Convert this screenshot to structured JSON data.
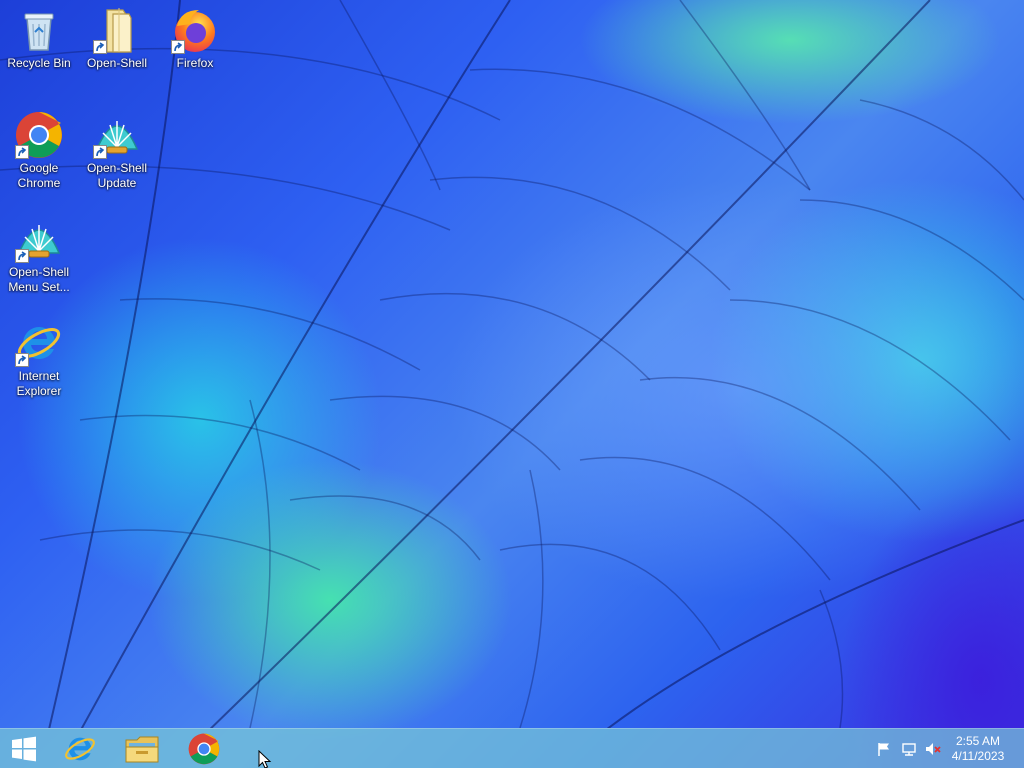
{
  "desktop_icons": [
    {
      "id": "recycle-bin",
      "label": "Recycle Bin",
      "shortcut": false
    },
    {
      "id": "open-shell",
      "label": "Open-Shell",
      "shortcut": true
    },
    {
      "id": "firefox",
      "label": "Firefox",
      "shortcut": true
    },
    {
      "id": "google-chrome",
      "label": "Google Chrome",
      "shortcut": true
    },
    {
      "id": "open-shell-update",
      "label": "Open-Shell Update",
      "shortcut": true
    },
    {
      "id": "open-shell-menu-settings",
      "label": "Open-Shell Menu Set...",
      "shortcut": true
    },
    {
      "id": "internet-explorer",
      "label": "Internet Explorer",
      "shortcut": true
    }
  ],
  "taskbar": {
    "pinned": [
      {
        "id": "start",
        "icon": "windows-logo-icon"
      },
      {
        "id": "internet-explorer",
        "icon": "internet-explorer-icon"
      },
      {
        "id": "file-explorer",
        "icon": "folder-icon"
      },
      {
        "id": "google-chrome",
        "icon": "chrome-icon"
      }
    ],
    "tray": {
      "icons": [
        "action-center-flag-icon",
        "network-icon",
        "speaker-muted-icon"
      ],
      "time": "2:55 AM",
      "date": "4/11/2023"
    }
  },
  "colors": {
    "taskbar": "#78c8d7",
    "wallpaper_blue": "#2e60f2",
    "wallpaper_cyan": "#3cdce6",
    "wallpaper_green": "#46ebaa"
  }
}
